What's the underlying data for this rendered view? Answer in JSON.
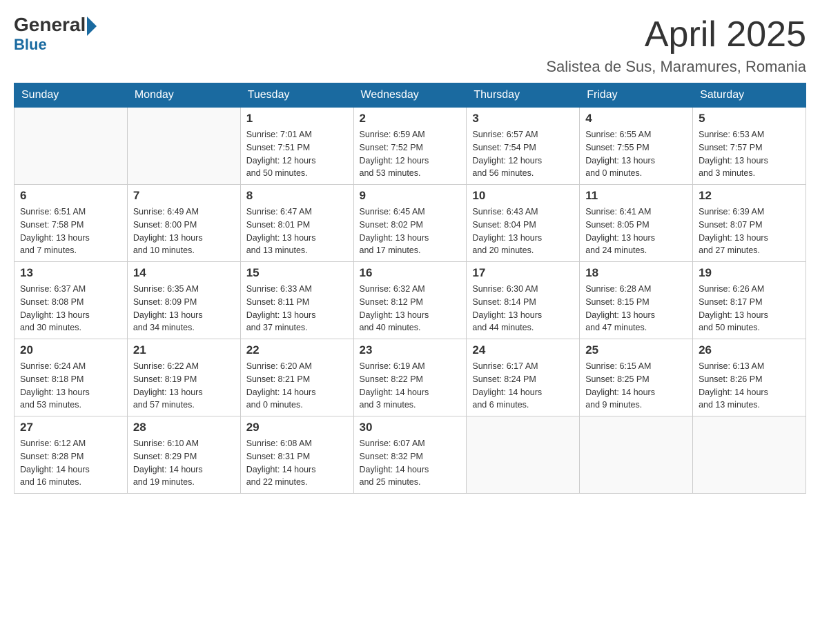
{
  "header": {
    "logo_general": "General",
    "logo_blue": "Blue",
    "month_title": "April 2025",
    "location": "Salistea de Sus, Maramures, Romania"
  },
  "weekdays": [
    "Sunday",
    "Monday",
    "Tuesday",
    "Wednesday",
    "Thursday",
    "Friday",
    "Saturday"
  ],
  "weeks": [
    [
      {
        "num": "",
        "info": ""
      },
      {
        "num": "",
        "info": ""
      },
      {
        "num": "1",
        "info": "Sunrise: 7:01 AM\nSunset: 7:51 PM\nDaylight: 12 hours\nand 50 minutes."
      },
      {
        "num": "2",
        "info": "Sunrise: 6:59 AM\nSunset: 7:52 PM\nDaylight: 12 hours\nand 53 minutes."
      },
      {
        "num": "3",
        "info": "Sunrise: 6:57 AM\nSunset: 7:54 PM\nDaylight: 12 hours\nand 56 minutes."
      },
      {
        "num": "4",
        "info": "Sunrise: 6:55 AM\nSunset: 7:55 PM\nDaylight: 13 hours\nand 0 minutes."
      },
      {
        "num": "5",
        "info": "Sunrise: 6:53 AM\nSunset: 7:57 PM\nDaylight: 13 hours\nand 3 minutes."
      }
    ],
    [
      {
        "num": "6",
        "info": "Sunrise: 6:51 AM\nSunset: 7:58 PM\nDaylight: 13 hours\nand 7 minutes."
      },
      {
        "num": "7",
        "info": "Sunrise: 6:49 AM\nSunset: 8:00 PM\nDaylight: 13 hours\nand 10 minutes."
      },
      {
        "num": "8",
        "info": "Sunrise: 6:47 AM\nSunset: 8:01 PM\nDaylight: 13 hours\nand 13 minutes."
      },
      {
        "num": "9",
        "info": "Sunrise: 6:45 AM\nSunset: 8:02 PM\nDaylight: 13 hours\nand 17 minutes."
      },
      {
        "num": "10",
        "info": "Sunrise: 6:43 AM\nSunset: 8:04 PM\nDaylight: 13 hours\nand 20 minutes."
      },
      {
        "num": "11",
        "info": "Sunrise: 6:41 AM\nSunset: 8:05 PM\nDaylight: 13 hours\nand 24 minutes."
      },
      {
        "num": "12",
        "info": "Sunrise: 6:39 AM\nSunset: 8:07 PM\nDaylight: 13 hours\nand 27 minutes."
      }
    ],
    [
      {
        "num": "13",
        "info": "Sunrise: 6:37 AM\nSunset: 8:08 PM\nDaylight: 13 hours\nand 30 minutes."
      },
      {
        "num": "14",
        "info": "Sunrise: 6:35 AM\nSunset: 8:09 PM\nDaylight: 13 hours\nand 34 minutes."
      },
      {
        "num": "15",
        "info": "Sunrise: 6:33 AM\nSunset: 8:11 PM\nDaylight: 13 hours\nand 37 minutes."
      },
      {
        "num": "16",
        "info": "Sunrise: 6:32 AM\nSunset: 8:12 PM\nDaylight: 13 hours\nand 40 minutes."
      },
      {
        "num": "17",
        "info": "Sunrise: 6:30 AM\nSunset: 8:14 PM\nDaylight: 13 hours\nand 44 minutes."
      },
      {
        "num": "18",
        "info": "Sunrise: 6:28 AM\nSunset: 8:15 PM\nDaylight: 13 hours\nand 47 minutes."
      },
      {
        "num": "19",
        "info": "Sunrise: 6:26 AM\nSunset: 8:17 PM\nDaylight: 13 hours\nand 50 minutes."
      }
    ],
    [
      {
        "num": "20",
        "info": "Sunrise: 6:24 AM\nSunset: 8:18 PM\nDaylight: 13 hours\nand 53 minutes."
      },
      {
        "num": "21",
        "info": "Sunrise: 6:22 AM\nSunset: 8:19 PM\nDaylight: 13 hours\nand 57 minutes."
      },
      {
        "num": "22",
        "info": "Sunrise: 6:20 AM\nSunset: 8:21 PM\nDaylight: 14 hours\nand 0 minutes."
      },
      {
        "num": "23",
        "info": "Sunrise: 6:19 AM\nSunset: 8:22 PM\nDaylight: 14 hours\nand 3 minutes."
      },
      {
        "num": "24",
        "info": "Sunrise: 6:17 AM\nSunset: 8:24 PM\nDaylight: 14 hours\nand 6 minutes."
      },
      {
        "num": "25",
        "info": "Sunrise: 6:15 AM\nSunset: 8:25 PM\nDaylight: 14 hours\nand 9 minutes."
      },
      {
        "num": "26",
        "info": "Sunrise: 6:13 AM\nSunset: 8:26 PM\nDaylight: 14 hours\nand 13 minutes."
      }
    ],
    [
      {
        "num": "27",
        "info": "Sunrise: 6:12 AM\nSunset: 8:28 PM\nDaylight: 14 hours\nand 16 minutes."
      },
      {
        "num": "28",
        "info": "Sunrise: 6:10 AM\nSunset: 8:29 PM\nDaylight: 14 hours\nand 19 minutes."
      },
      {
        "num": "29",
        "info": "Sunrise: 6:08 AM\nSunset: 8:31 PM\nDaylight: 14 hours\nand 22 minutes."
      },
      {
        "num": "30",
        "info": "Sunrise: 6:07 AM\nSunset: 8:32 PM\nDaylight: 14 hours\nand 25 minutes."
      },
      {
        "num": "",
        "info": ""
      },
      {
        "num": "",
        "info": ""
      },
      {
        "num": "",
        "info": ""
      }
    ]
  ]
}
